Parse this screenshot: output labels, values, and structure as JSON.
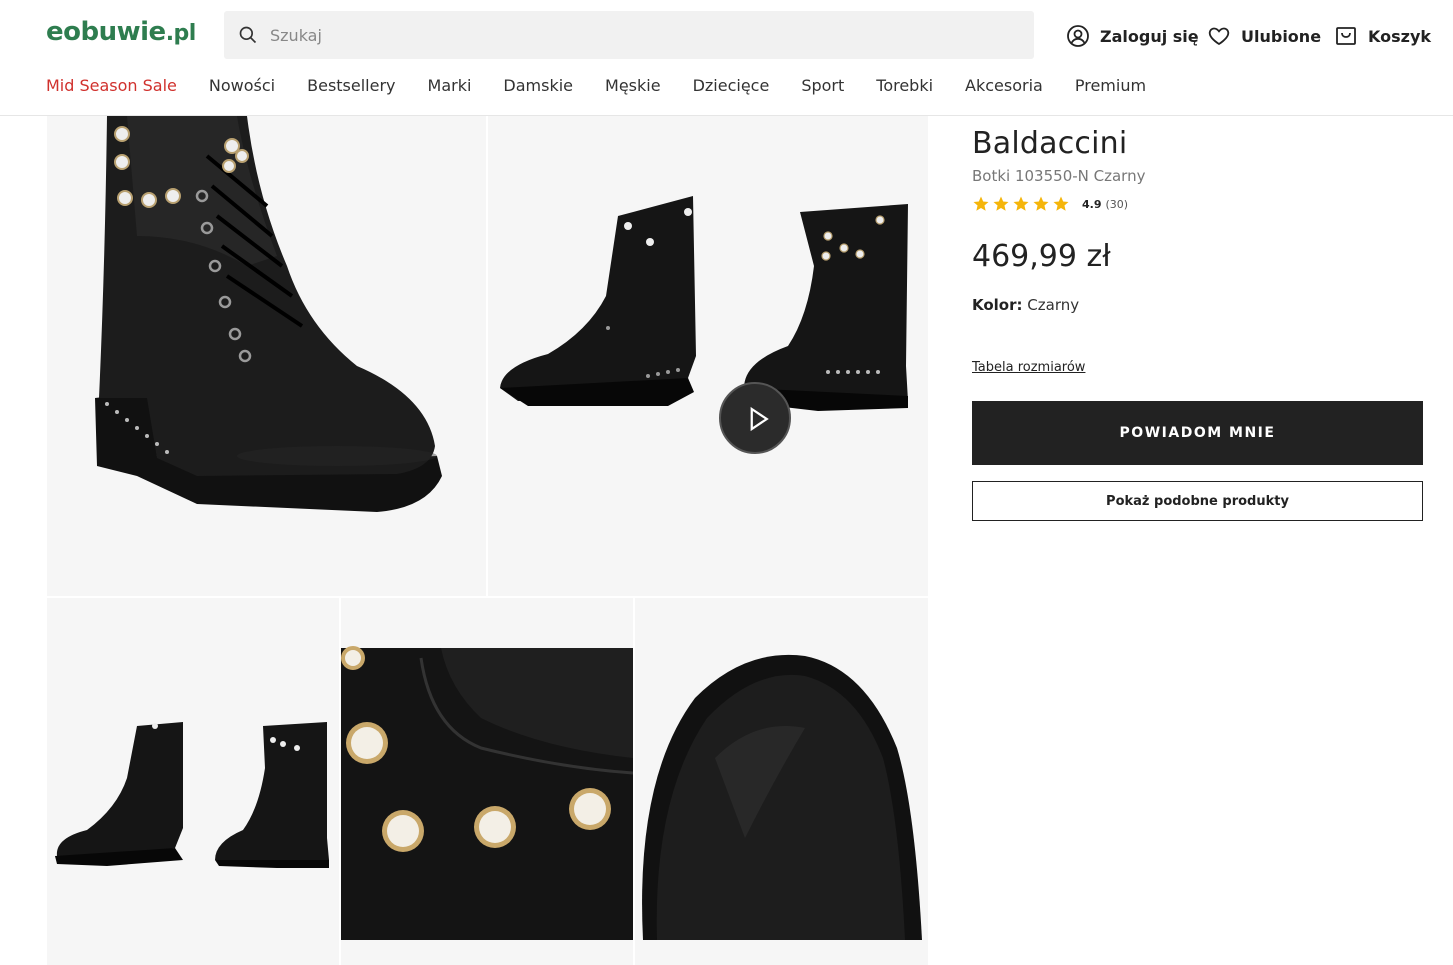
{
  "header": {
    "logo_main": "eobuwie",
    "logo_suffix": ".pl",
    "search_placeholder": "Szukaj",
    "login_label": "Zaloguj się",
    "favorites_label": "Ulubione",
    "cart_label": "Koszyk"
  },
  "nav": {
    "items": [
      {
        "label": "Mid Season Sale"
      },
      {
        "label": "Nowości"
      },
      {
        "label": "Bestsellery"
      },
      {
        "label": "Marki"
      },
      {
        "label": "Damskie"
      },
      {
        "label": "Męskie"
      },
      {
        "label": "Dziecięce"
      },
      {
        "label": "Sport"
      },
      {
        "label": "Torebki"
      },
      {
        "label": "Akcesoria"
      },
      {
        "label": "Premium"
      }
    ]
  },
  "product": {
    "brand": "Baldaccini",
    "model": "Botki 103550-N Czarny",
    "rating_score": "4.9",
    "rating_count": "(30)",
    "rating_value": 4.9,
    "price": "469,99 zł",
    "color_label": "Kolor:",
    "color_value": "Czarny",
    "size_table_link": "Tabela rozmiarów",
    "notify_button": "POWIADOM MNIE",
    "similar_button": "Pokaż podobne produkty"
  },
  "gallery": {
    "images": [
      {
        "name": "main-photo"
      },
      {
        "name": "video-thumbnail"
      },
      {
        "name": "pair-side-photo"
      },
      {
        "name": "pearl-detail-photo"
      },
      {
        "name": "toe-detail-photo"
      }
    ]
  },
  "colors": {
    "brand_green": "#2e7d4f",
    "sale_red": "#d0312d",
    "star_yellow": "#f5b50a",
    "button_dark": "#222222"
  }
}
